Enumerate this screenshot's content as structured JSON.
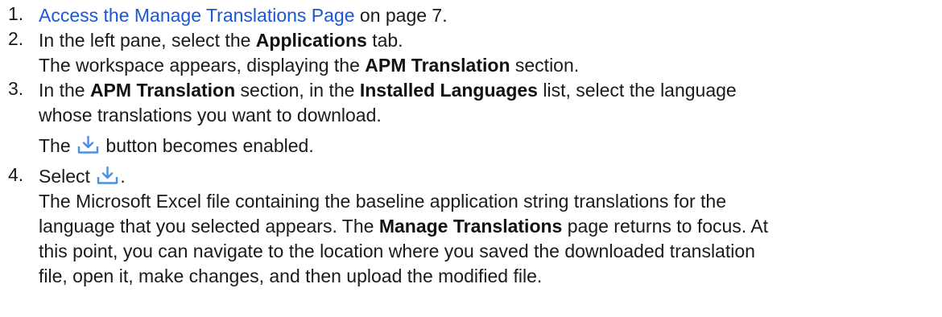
{
  "steps": [
    {
      "number": "1.",
      "link_text": "Access the Manage Translations Page",
      "text_after_link": " on page 7."
    },
    {
      "number": "2.",
      "line1_pre": "In the left pane, select the ",
      "line1_bold": "Applications",
      "line1_post": " tab.",
      "line2_pre": "The workspace appears, displaying the ",
      "line2_bold": "APM Translation",
      "line2_post": " section."
    },
    {
      "number": "3.",
      "line1_pre": "In the ",
      "line1_bold1": "APM Translation",
      "line1_mid": " section, in the ",
      "line1_bold2": "Installed Languages",
      "line1_post": " list, select the language",
      "line2": "whose translations you want to download.",
      "line3_pre": "The ",
      "line3_post": " button becomes enabled."
    },
    {
      "number": "4.",
      "line1_pre": "Select ",
      "line1_post": ".",
      "line2": "The Microsoft Excel file containing the baseline application string translations for the",
      "line3_pre": "language that you selected appears. The ",
      "line3_bold": "Manage Translations",
      "line3_post": " page returns to focus. At",
      "line4": "this point, you can navigate to the location where you saved the downloaded translation",
      "line5": "file, open it, make changes, and then upload the modified file."
    }
  ],
  "icons": {
    "download": "download-icon",
    "accent_color": "#4a90e2"
  }
}
